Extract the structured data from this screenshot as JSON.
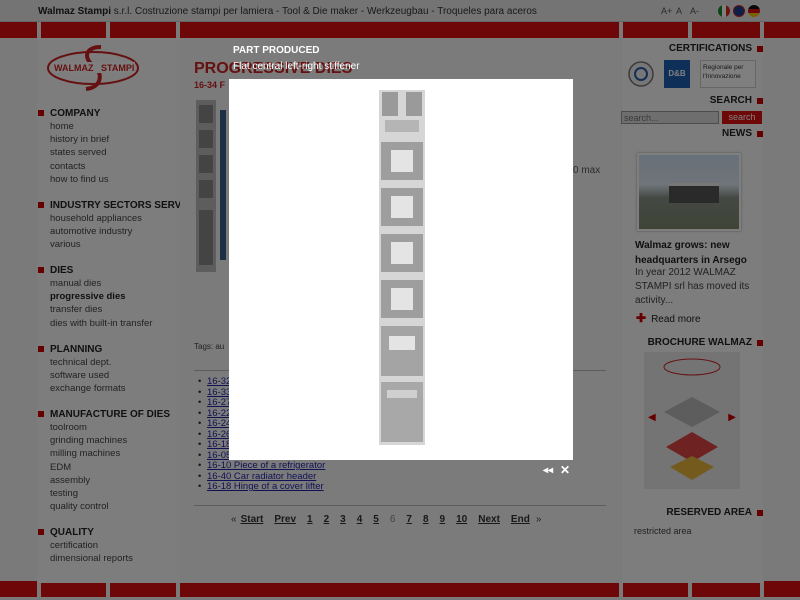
{
  "header": {
    "company_name": "Walmaz Stampi",
    "company_tagline": "s.r.l. Costruzione stampi per lamiera - Tool & Die maker - Werkzeugbau - Troqueles para aceros",
    "font_controls": [
      "A+",
      "A",
      "A-"
    ],
    "languages": [
      "Italiano",
      "English",
      "Deutsch"
    ]
  },
  "logo": {
    "text_left": "WALMAZ",
    "text_right": "STAMPI"
  },
  "nav": [
    {
      "title": "COMPANY",
      "items": [
        "home",
        "history in brief",
        "states served",
        "contacts",
        "how to find us"
      ]
    },
    {
      "title": "INDUSTRY SECTORS SERVED",
      "items": [
        "household appliances",
        "automotive industry",
        "various"
      ]
    },
    {
      "title": "DIES",
      "items": [
        "manual dies",
        "progressive dies",
        "transfer dies",
        "dies with built-in transfer"
      ],
      "active": "progressive dies"
    },
    {
      "title": "PLANNING",
      "items": [
        "technical dept.",
        "software used",
        "exchange formats"
      ]
    },
    {
      "title": "MANUFACTURE OF DIES",
      "items": [
        "toolroom",
        "grinding machines",
        "milling machines",
        "EDM",
        "assembly",
        "testing",
        "quality control"
      ]
    },
    {
      "title": "QUALITY",
      "items": [
        "certification",
        "dimensional reports"
      ]
    }
  ],
  "main": {
    "title": "PROGRESSIVE DIES",
    "subtitle": "16-34 F",
    "side_text": "0 max",
    "tags_label": "Tags:",
    "tags_value": "au",
    "parts": [
      "16-32",
      "16-33",
      "16-27",
      "16-22",
      "16-24",
      "16-26",
      "16-18",
      "16-05",
      "16-10 Piece of a refrigerator",
      "16-40 Car radiator header",
      "16-18 Hinge of a cover lifter"
    ],
    "pagination": {
      "first": "Start",
      "prev": "Prev",
      "pages": [
        "1",
        "2",
        "3",
        "4",
        "5",
        "6",
        "7",
        "8",
        "9",
        "10"
      ],
      "current": "6",
      "next": "Next",
      "last": "End",
      "open_quote": "«",
      "close_quote": "»"
    }
  },
  "sidebar": {
    "certifications_label": "CERTIFICATIONS",
    "cert_badges": [
      "D&B",
      "Regionale per l'Innovazione"
    ],
    "search_label": "SEARCH",
    "search_placeholder": "search...",
    "search_button": "search",
    "news_label": "NEWS",
    "news_title": "Walmaz grows: new headquarters in Arsego",
    "news_body": "In year 2012 WALMAZ STAMPI srl has moved its activity...",
    "read_more": "Read more",
    "brochure_label": "BROCHURE WALMAZ",
    "reserved_label": "RESERVED AREA",
    "restricted_text": "restricted area"
  },
  "popup": {
    "title": "PART PRODUCED",
    "caption": "Flat central left-right stiffener",
    "prev_label": "◂◂",
    "close_label": "✕"
  }
}
